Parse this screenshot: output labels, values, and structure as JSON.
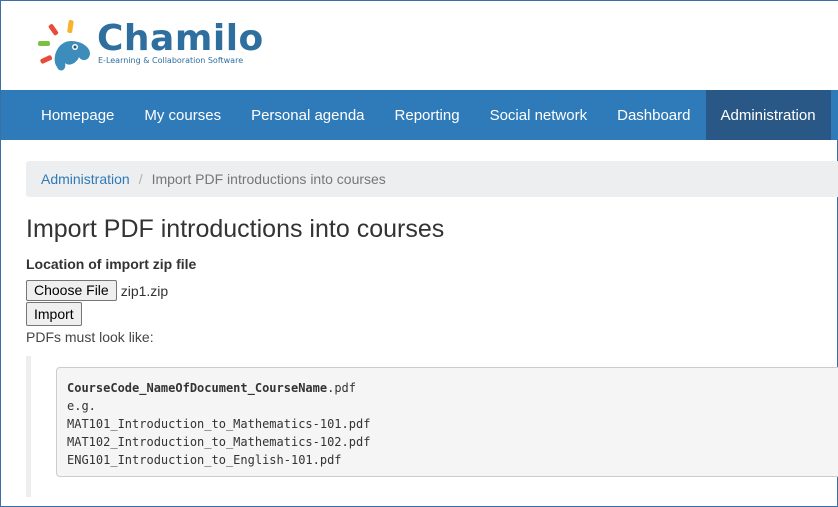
{
  "brand": {
    "name": "Chamilo",
    "tagline": "E-Learning & Collaboration Software",
    "colors": {
      "text": "#2f6f9f",
      "rays": [
        "#f7b32b",
        "#e84b3c",
        "#7ac143",
        "#3aa0d8",
        "#f39c12"
      ]
    }
  },
  "nav": {
    "items": [
      {
        "label": "Homepage"
      },
      {
        "label": "My courses"
      },
      {
        "label": "Personal agenda"
      },
      {
        "label": "Reporting"
      },
      {
        "label": "Social network"
      },
      {
        "label": "Dashboard"
      },
      {
        "label": "Administration",
        "active": true
      }
    ],
    "colors": {
      "bar": "#2f7ab8",
      "active": "#2a5886"
    }
  },
  "breadcrumb": {
    "link": "Administration",
    "separator": "/",
    "current": "Import PDF introductions into courses"
  },
  "main": {
    "title": "Import PDF introductions into courses",
    "field_label": "Location of import zip file",
    "choose_file_label": "Choose File",
    "file_name": "zip1.zip",
    "import_label": "Import",
    "hint": "PDFs must look like:",
    "example": {
      "pattern_bold": "CourseCode_NameOfDocument_CourseName",
      "pattern_ext": ".pdf",
      "eg": "e.g.",
      "lines": [
        "MAT101_Introduction_to_Mathematics-101.pdf",
        "MAT102_Introduction_to_Mathematics-102.pdf",
        "ENG101_Introduction_to_English-101.pdf"
      ]
    }
  }
}
